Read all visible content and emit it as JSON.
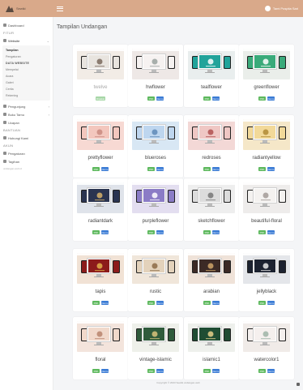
{
  "brand": {
    "logo_text": "Sewiki",
    "accent": "#d9a98a"
  },
  "topbar": {
    "user_name": "Tami Puspita Sari"
  },
  "sidebar": {
    "dashboard": "Dashboard",
    "heading_fitur": "FITUR",
    "website": "Website",
    "submenu": [
      "Tampilan",
      "Pengaturan",
      "DATA WEBSITE",
      "Mempelai",
      "Acara",
      "Galeri",
      "Cerita",
      "Rekening"
    ],
    "pengunjung": "Pengunjung",
    "buku_tamu": "Buku Tamu",
    "ucapan": "Ucapan",
    "heading_bantuan": "BANTUAN",
    "hubungi": "Hubungi Kami",
    "heading_akun": "AKUN",
    "pengaturan": "Pengaturan",
    "tagihan": "Tagihan",
    "footer_small": "undangan.web.id"
  },
  "page": {
    "title": "Tampilan Undangan"
  },
  "buttons": {
    "pilih": "Pilih",
    "demo": "Demo",
    "used": "Dipakai"
  },
  "templates": [
    {
      "name": "twelve",
      "bg": "#f2ece6",
      "screen": "#e8e4df",
      "accent": "#7a6a5e",
      "used": true
    },
    {
      "name": "hwflower",
      "bg": "#eee8e6",
      "screen": "#f6f2f1",
      "accent": "#9aa3a0",
      "used": false
    },
    {
      "name": "tealflower",
      "bg": "#e9eeee",
      "screen": "#21a39a",
      "accent": "#ffffff",
      "used": false
    },
    {
      "name": "greenflower",
      "bg": "#eaeeea",
      "screen": "#3aaa7a",
      "accent": "#ffffff",
      "used": false
    },
    {
      "name": "prettyflower",
      "bg": "#f7d9d3",
      "screen": "#f3c7be",
      "accent": "#c98a80",
      "used": false
    },
    {
      "name": "blueroses",
      "bg": "#d8e7f4",
      "screen": "#bed6ef",
      "accent": "#5f89b7",
      "used": false
    },
    {
      "name": "redroses",
      "bg": "#f3d8d6",
      "screen": "#efc7c4",
      "accent": "#b05050",
      "used": false
    },
    {
      "name": "radiantyellow",
      "bg": "#f5e7c8",
      "screen": "#f2d999",
      "accent": "#b08a35",
      "used": false
    },
    {
      "name": "radiantdark",
      "bg": "#dfe3ea",
      "screen": "#2a3450",
      "accent": "#d6b26a",
      "used": false
    },
    {
      "name": "purpleflower",
      "bg": "#e3def0",
      "screen": "#8b7cc6",
      "accent": "#ffffff",
      "used": false
    },
    {
      "name": "sketchflower",
      "bg": "#eeeeee",
      "screen": "#dcdcdc",
      "accent": "#777777",
      "used": false
    },
    {
      "name": "beautiful-floral",
      "bg": "#eeeceb",
      "screen": "#f4f2f0",
      "accent": "#a29b96",
      "used": false
    },
    {
      "name": "tapis",
      "bg": "#f1e2d5",
      "screen": "#8c1b1b",
      "accent": "#e0b04a",
      "used": false
    },
    {
      "name": "rustic",
      "bg": "#f0e6da",
      "screen": "#e3d2bb",
      "accent": "#8c6b45",
      "used": false
    },
    {
      "name": "arabian",
      "bg": "#efe2d8",
      "screen": "#3c2a26",
      "accent": "#cfa56a",
      "used": false
    },
    {
      "name": "jellyblack",
      "bg": "#e4e6ea",
      "screen": "#1c2230",
      "accent": "#e8e8e8",
      "used": false
    },
    {
      "name": "floral",
      "bg": "#f3e4dc",
      "screen": "#f1d9cb",
      "accent": "#b9846d",
      "used": false
    },
    {
      "name": "vintage-islamic",
      "bg": "#eef0ea",
      "screen": "#2f5b3b",
      "accent": "#d9c47c",
      "used": false
    },
    {
      "name": "islamic1",
      "bg": "#eef0ec",
      "screen": "#1f4d33",
      "accent": "#e6d08a",
      "used": false
    },
    {
      "name": "watercolor1",
      "bg": "#f0ebe8",
      "screen": "#f5f0ee",
      "accent": "#9db4a6",
      "used": false
    }
  ],
  "footer": {
    "text": "Copyright © 2023 Sewiki.undangan.web"
  }
}
